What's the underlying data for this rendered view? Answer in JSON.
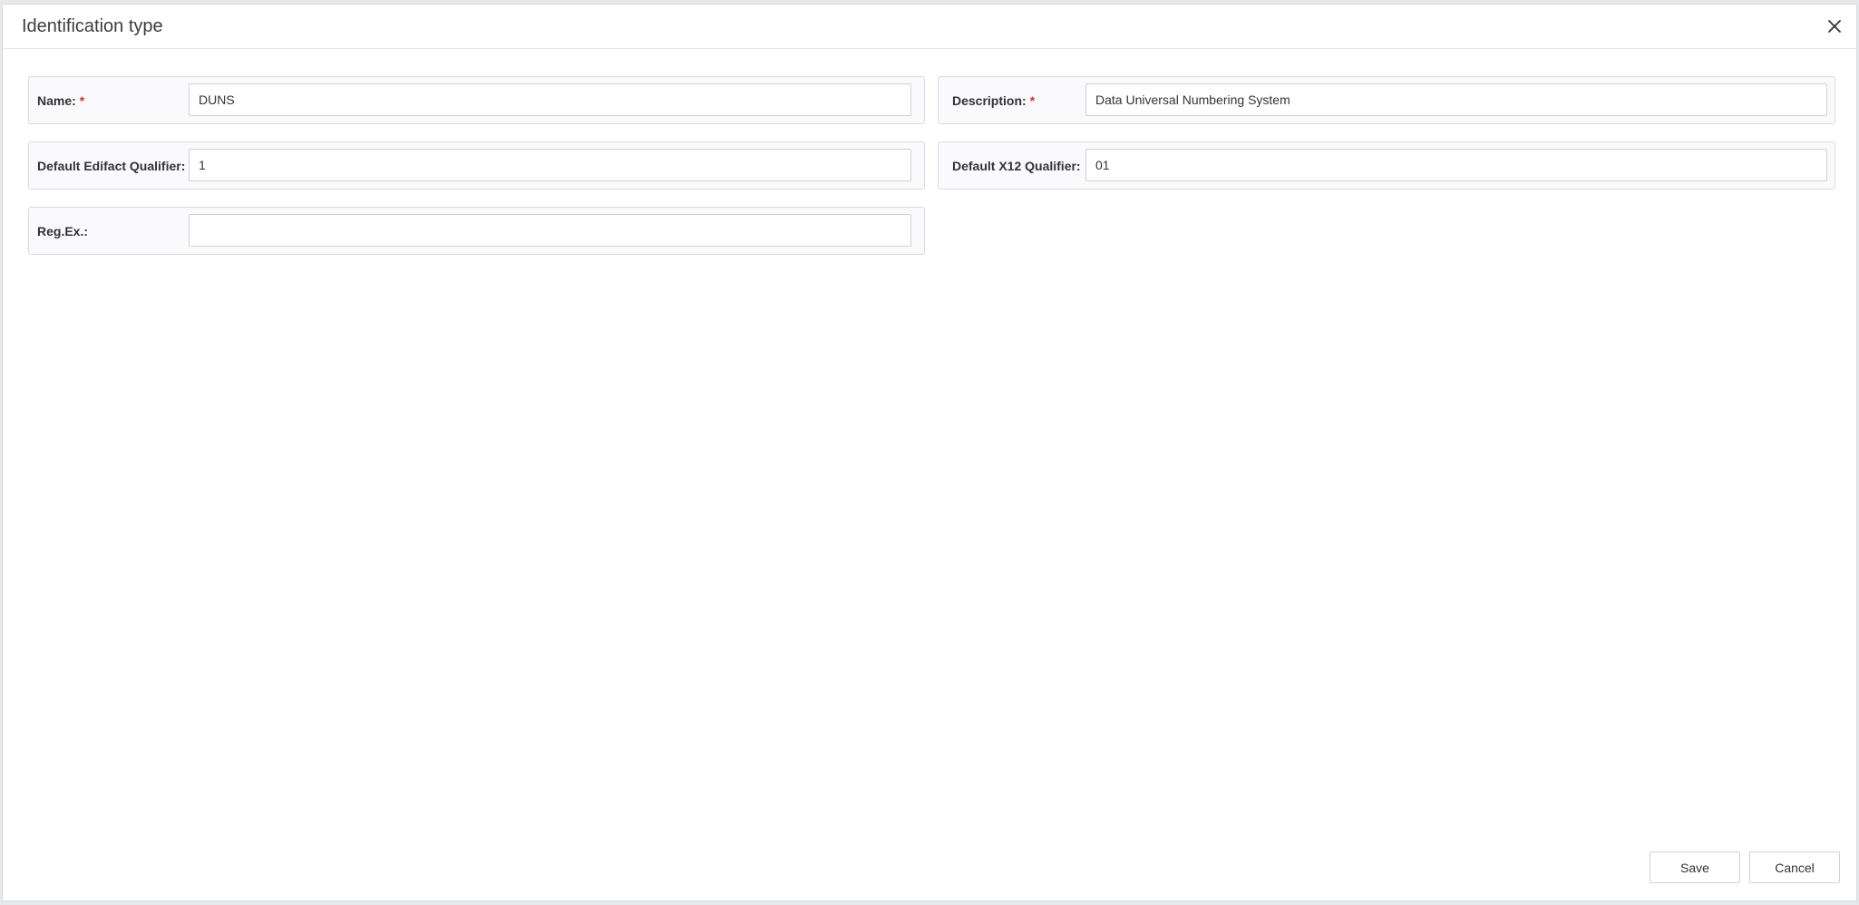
{
  "dialog": {
    "title": "Identification type",
    "close_icon": "close-icon"
  },
  "form": {
    "name": {
      "label": "Name:",
      "required_mark": "*",
      "value": "DUNS"
    },
    "description": {
      "label": "Description:",
      "required_mark": "*",
      "value": "Data Universal Numbering System"
    },
    "edifact_qualifier": {
      "label": "Default Edifact Qualifier:",
      "value": "1"
    },
    "x12_qualifier": {
      "label": "Default X12 Qualifier:",
      "value": "01"
    },
    "regex": {
      "label": "Reg.Ex.:",
      "value": ""
    }
  },
  "footer": {
    "save_label": "Save",
    "cancel_label": "Cancel"
  },
  "colors": {
    "required": "#d9302c",
    "field_background": "#fafafc",
    "border": "#d9dce0"
  }
}
